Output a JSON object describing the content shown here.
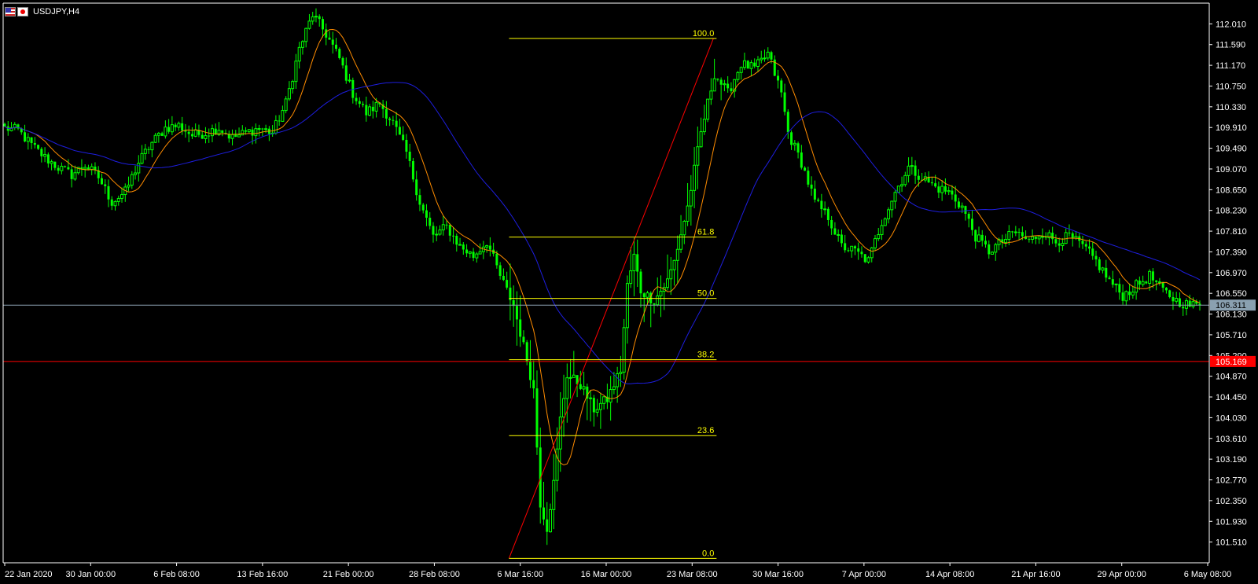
{
  "window": {
    "symbol": "USDJPY,H4"
  },
  "chart_data": {
    "type": "candlestick",
    "symbol": "USDJPY",
    "timeframe": "H4",
    "ylim": [
      101.09,
      112.43
    ],
    "y_ticks": [
      "112.010",
      "111.590",
      "111.170",
      "110.750",
      "110.330",
      "109.910",
      "109.490",
      "109.070",
      "108.650",
      "108.230",
      "107.810",
      "107.390",
      "106.970",
      "106.550",
      "106.130",
      "105.710",
      "105.290",
      "104.870",
      "104.450",
      "104.030",
      "103.610",
      "103.190",
      "102.770",
      "102.350",
      "101.930",
      "101.510"
    ],
    "x_ticks": [
      "22 Jan 2020",
      "30 Jan 00:00",
      "6 Feb 08:00",
      "13 Feb 16:00",
      "21 Feb 00:00",
      "28 Feb 08:00",
      "6 Mar 16:00",
      "16 Mar 00:00",
      "23 Mar 08:00",
      "30 Mar 16:00",
      "7 Apr 00:00",
      "14 Apr 08:00",
      "21 Apr 16:00",
      "29 Apr 00:00",
      "6 May 08:00"
    ],
    "close_path": [
      [
        0,
        109.9
      ],
      [
        4,
        109.85
      ],
      [
        8,
        109.55
      ],
      [
        12,
        109.3
      ],
      [
        16,
        109.1
      ],
      [
        20,
        108.95
      ],
      [
        24,
        109.15
      ],
      [
        28,
        108.9
      ],
      [
        32,
        108.4
      ],
      [
        36,
        108.6
      ],
      [
        40,
        109.2
      ],
      [
        44,
        109.6
      ],
      [
        48,
        109.9
      ],
      [
        52,
        109.95
      ],
      [
        56,
        109.75
      ],
      [
        60,
        109.8
      ],
      [
        64,
        109.9
      ],
      [
        68,
        109.7
      ],
      [
        72,
        109.8
      ],
      [
        76,
        109.9
      ],
      [
        80,
        109.8
      ],
      [
        84,
        110.4
      ],
      [
        88,
        111.5
      ],
      [
        92,
        112.2
      ],
      [
        96,
        111.8
      ],
      [
        100,
        111.3
      ],
      [
        104,
        110.6
      ],
      [
        108,
        110.2
      ],
      [
        112,
        110.4
      ],
      [
        116,
        110.0
      ],
      [
        120,
        109.4
      ],
      [
        124,
        108.4
      ],
      [
        128,
        107.7
      ],
      [
        132,
        107.9
      ],
      [
        136,
        107.5
      ],
      [
        140,
        107.3
      ],
      [
        144,
        107.6
      ],
      [
        148,
        106.9
      ],
      [
        152,
        106.3
      ],
      [
        156,
        105.2
      ],
      [
        158,
        104.6
      ],
      [
        160,
        102.3
      ],
      [
        162,
        101.8
      ],
      [
        164,
        102.7
      ],
      [
        166,
        104.0
      ],
      [
        168,
        104.9
      ],
      [
        172,
        104.7
      ],
      [
        176,
        104.2
      ],
      [
        180,
        104.4
      ],
      [
        184,
        105.0
      ],
      [
        186,
        106.7
      ],
      [
        188,
        107.3
      ],
      [
        190,
        106.6
      ],
      [
        194,
        106.4
      ],
      [
        198,
        106.8
      ],
      [
        200,
        107.2
      ],
      [
        204,
        108.3
      ],
      [
        208,
        109.8
      ],
      [
        212,
        111.0
      ],
      [
        216,
        110.6
      ],
      [
        220,
        111.2
      ],
      [
        224,
        111.1
      ],
      [
        228,
        111.4
      ],
      [
        232,
        110.6
      ],
      [
        234,
        109.8
      ],
      [
        238,
        109.2
      ],
      [
        242,
        108.4
      ],
      [
        246,
        108.1
      ],
      [
        250,
        107.5
      ],
      [
        254,
        107.4
      ],
      [
        258,
        107.2
      ],
      [
        262,
        108.0
      ],
      [
        266,
        108.6
      ],
      [
        270,
        109.1
      ],
      [
        274,
        108.9
      ],
      [
        278,
        108.7
      ],
      [
        282,
        108.6
      ],
      [
        286,
        108.3
      ],
      [
        290,
        107.7
      ],
      [
        294,
        107.4
      ],
      [
        298,
        107.6
      ],
      [
        302,
        107.8
      ],
      [
        306,
        107.6
      ],
      [
        310,
        107.8
      ],
      [
        314,
        107.6
      ],
      [
        318,
        107.7
      ],
      [
        322,
        107.5
      ],
      [
        326,
        107.2
      ],
      [
        330,
        106.8
      ],
      [
        334,
        106.5
      ],
      [
        338,
        106.7
      ],
      [
        342,
        106.9
      ],
      [
        346,
        106.6
      ],
      [
        350,
        106.4
      ],
      [
        354,
        106.3
      ],
      [
        357,
        106.31
      ]
    ],
    "bar_count": 358,
    "series": [
      {
        "name": "",
        "kind": "price",
        "color": "#00ff00"
      },
      {
        "name": "",
        "kind": "ma_fast",
        "period": 10,
        "color": "#ff8c00"
      },
      {
        "name": "",
        "kind": "ma_slow",
        "period": 40,
        "color": "#1e1ee0"
      }
    ],
    "price_line": {
      "value": 106.311,
      "label": "106.311",
      "color": "#8aa0b0"
    },
    "red_line": {
      "value": 105.169,
      "label": "105.169",
      "color": "#ff0000"
    },
    "fibonacci": {
      "color": "#ffff00",
      "from": {
        "bar": 153,
        "price": 101.18
      },
      "to": {
        "bar": 207,
        "price": 111.715
      },
      "trend_color": "#ff0000",
      "levels": [
        {
          "ratio": 0.0,
          "label": "0.0"
        },
        {
          "ratio": 0.236,
          "label": "23.6"
        },
        {
          "ratio": 0.382,
          "label": "38.2"
        },
        {
          "ratio": 0.5,
          "label": "50.0"
        },
        {
          "ratio": 0.618,
          "label": "61.8"
        },
        {
          "ratio": 1.0,
          "label": "100.0"
        }
      ]
    },
    "colors": {
      "background": "#000000",
      "axis": "#ffffff",
      "grid": "none"
    }
  }
}
